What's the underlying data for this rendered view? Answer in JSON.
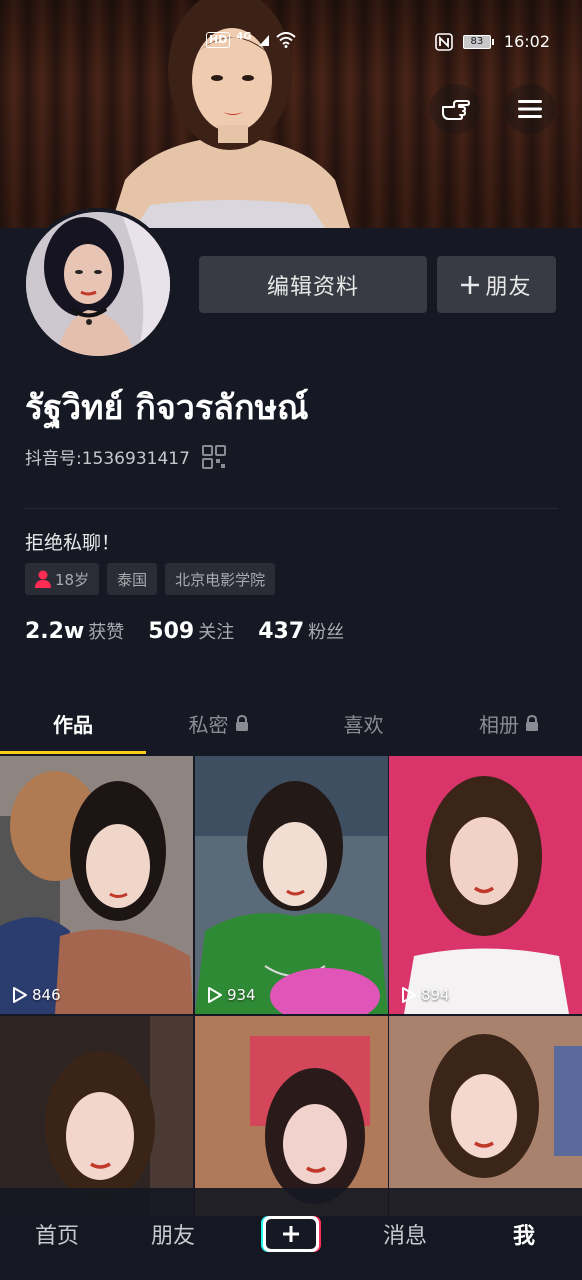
{
  "status_bar": {
    "hd": "HD",
    "network": "4G",
    "battery": "83",
    "time": "16:02"
  },
  "profile": {
    "nickname": "รัฐวิทย์ กิจวรลักษณ์",
    "douyin_id_label": "抖音号:",
    "douyin_id": "1536931417",
    "bio": "拒绝私聊！",
    "tags": {
      "age": "18岁",
      "country": "泰国",
      "school": "北京电影学院"
    },
    "stats": {
      "likes_num": "2.2w",
      "likes_label": "获赞",
      "following_num": "509",
      "following_label": "关注",
      "followers_num": "437",
      "followers_label": "粉丝"
    }
  },
  "buttons": {
    "edit_profile": "编辑资料",
    "add_friend": "朋友"
  },
  "tabs": {
    "works": "作品",
    "private": "私密",
    "likes": "喜欢",
    "album": "相册"
  },
  "videos": [
    {
      "plays": "846"
    },
    {
      "plays": "934"
    },
    {
      "plays": "894"
    }
  ],
  "nav": {
    "home": "首页",
    "friends": "朋友",
    "messages": "消息",
    "me": "我"
  },
  "colors": {
    "background": "#161823",
    "accent_yellow": "#face15",
    "button_bg": "#393b44",
    "tag_bg": "#2a2c36",
    "age_icon": "#fe2c55"
  },
  "icons": {
    "hand": "hand-pointing-icon",
    "menu": "hamburger-menu-icon",
    "qr": "qr-code-icon",
    "lock": "lock-icon",
    "play": "play-icon",
    "plus": "plus-icon",
    "person": "person-icon"
  }
}
